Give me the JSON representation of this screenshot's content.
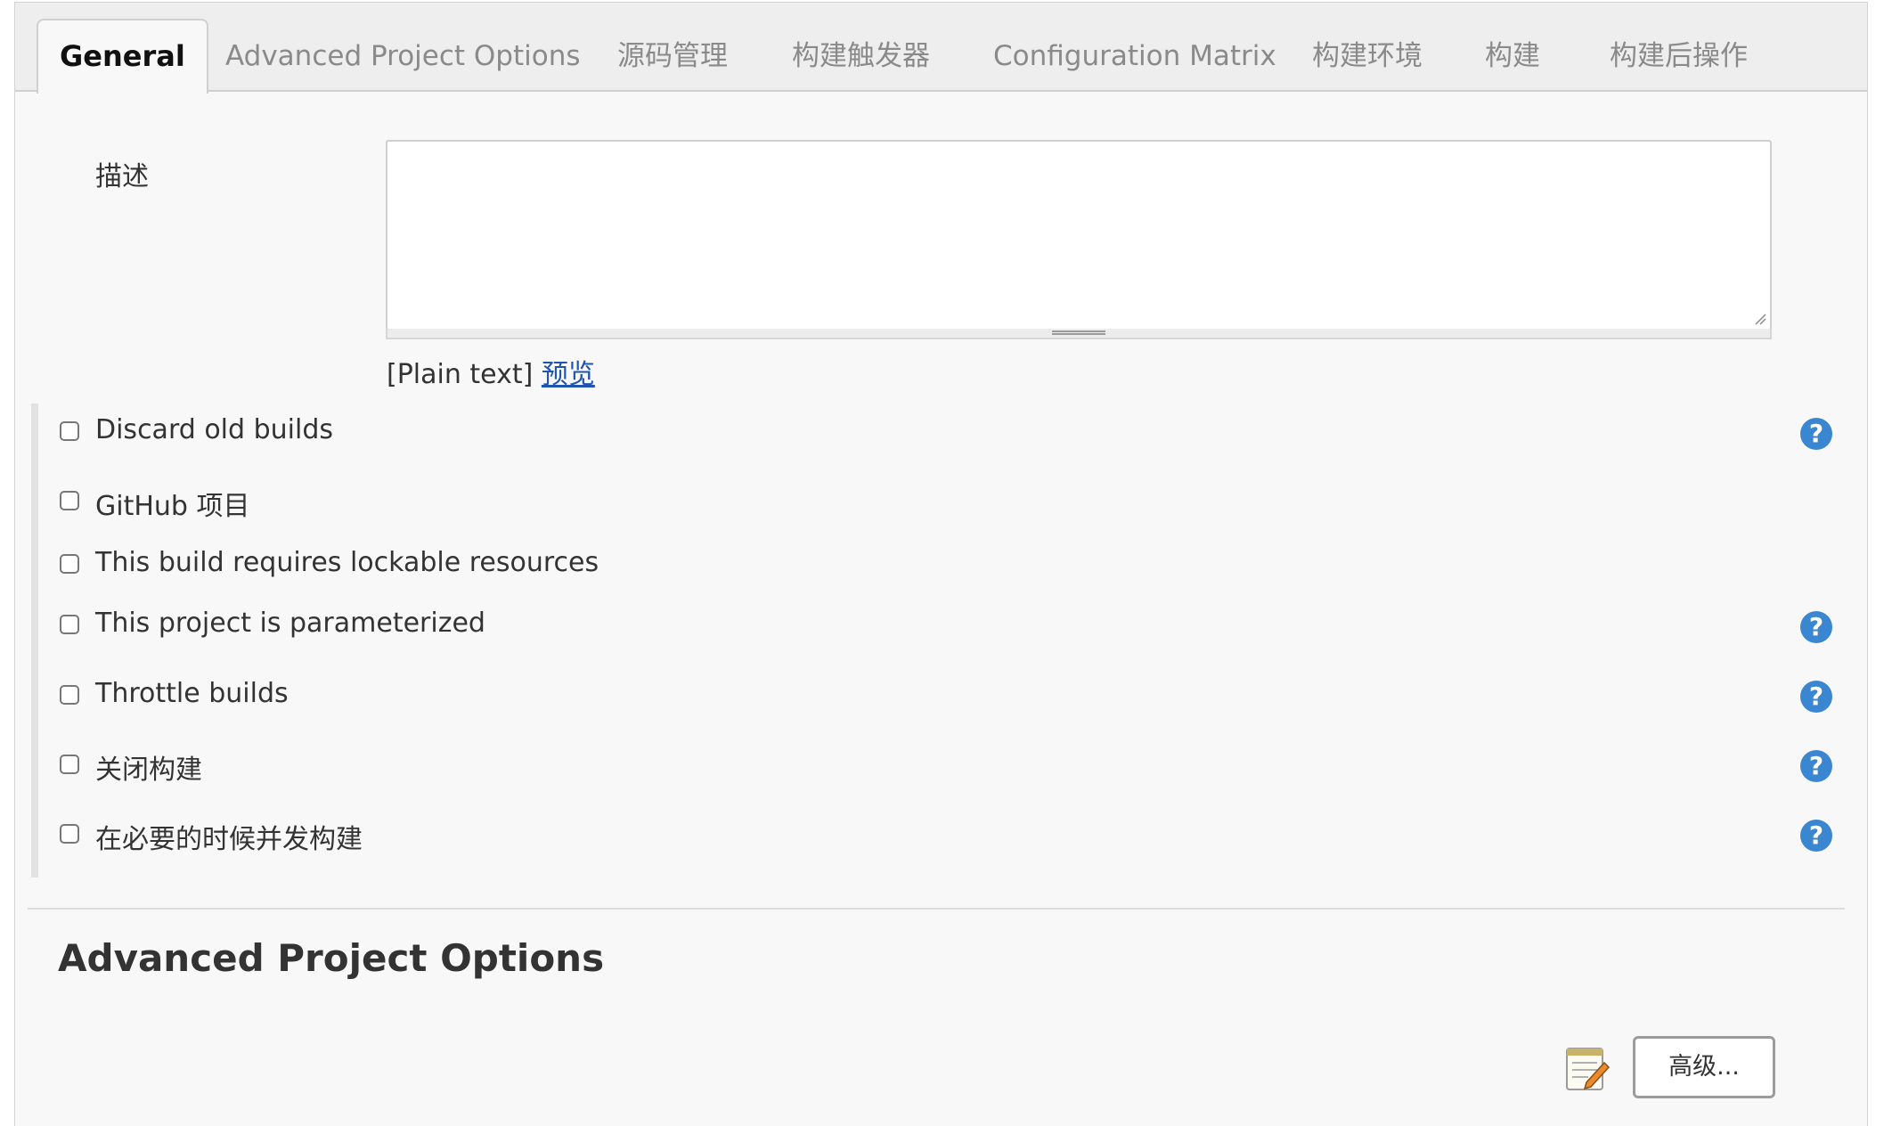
{
  "tabs": [
    {
      "label": "General",
      "active": true
    },
    {
      "label": "Advanced Project Options",
      "active": false
    },
    {
      "label": "源码管理",
      "active": false
    },
    {
      "label": "构建触发器",
      "active": false
    },
    {
      "label": "Configuration Matrix",
      "active": false
    },
    {
      "label": "构建环境",
      "active": false
    },
    {
      "label": "构建",
      "active": false
    },
    {
      "label": "构建后操作",
      "active": false
    }
  ],
  "description": {
    "label": "描述",
    "value": "",
    "format_label": "[Plain text]",
    "preview_link": "预览"
  },
  "options": [
    {
      "label": "Discard old builds",
      "checked": false,
      "help": true
    },
    {
      "label": "GitHub 项目",
      "checked": false,
      "help": false
    },
    {
      "label": "This build requires lockable resources",
      "checked": false,
      "help": false
    },
    {
      "label": "This project is parameterized",
      "checked": false,
      "help": true
    },
    {
      "label": "Throttle builds",
      "checked": false,
      "help": true
    },
    {
      "label": "关闭构建",
      "checked": false,
      "help": true
    },
    {
      "label": "在必要的时候并发构建",
      "checked": false,
      "help": true
    }
  ],
  "help_glyph": "?",
  "advanced_section": {
    "title": "Advanced Project Options",
    "button_label": "高级..."
  },
  "colors": {
    "help_icon": "#3a86d0",
    "link": "#1f55b0",
    "tab_inactive": "#8a8a8a"
  }
}
